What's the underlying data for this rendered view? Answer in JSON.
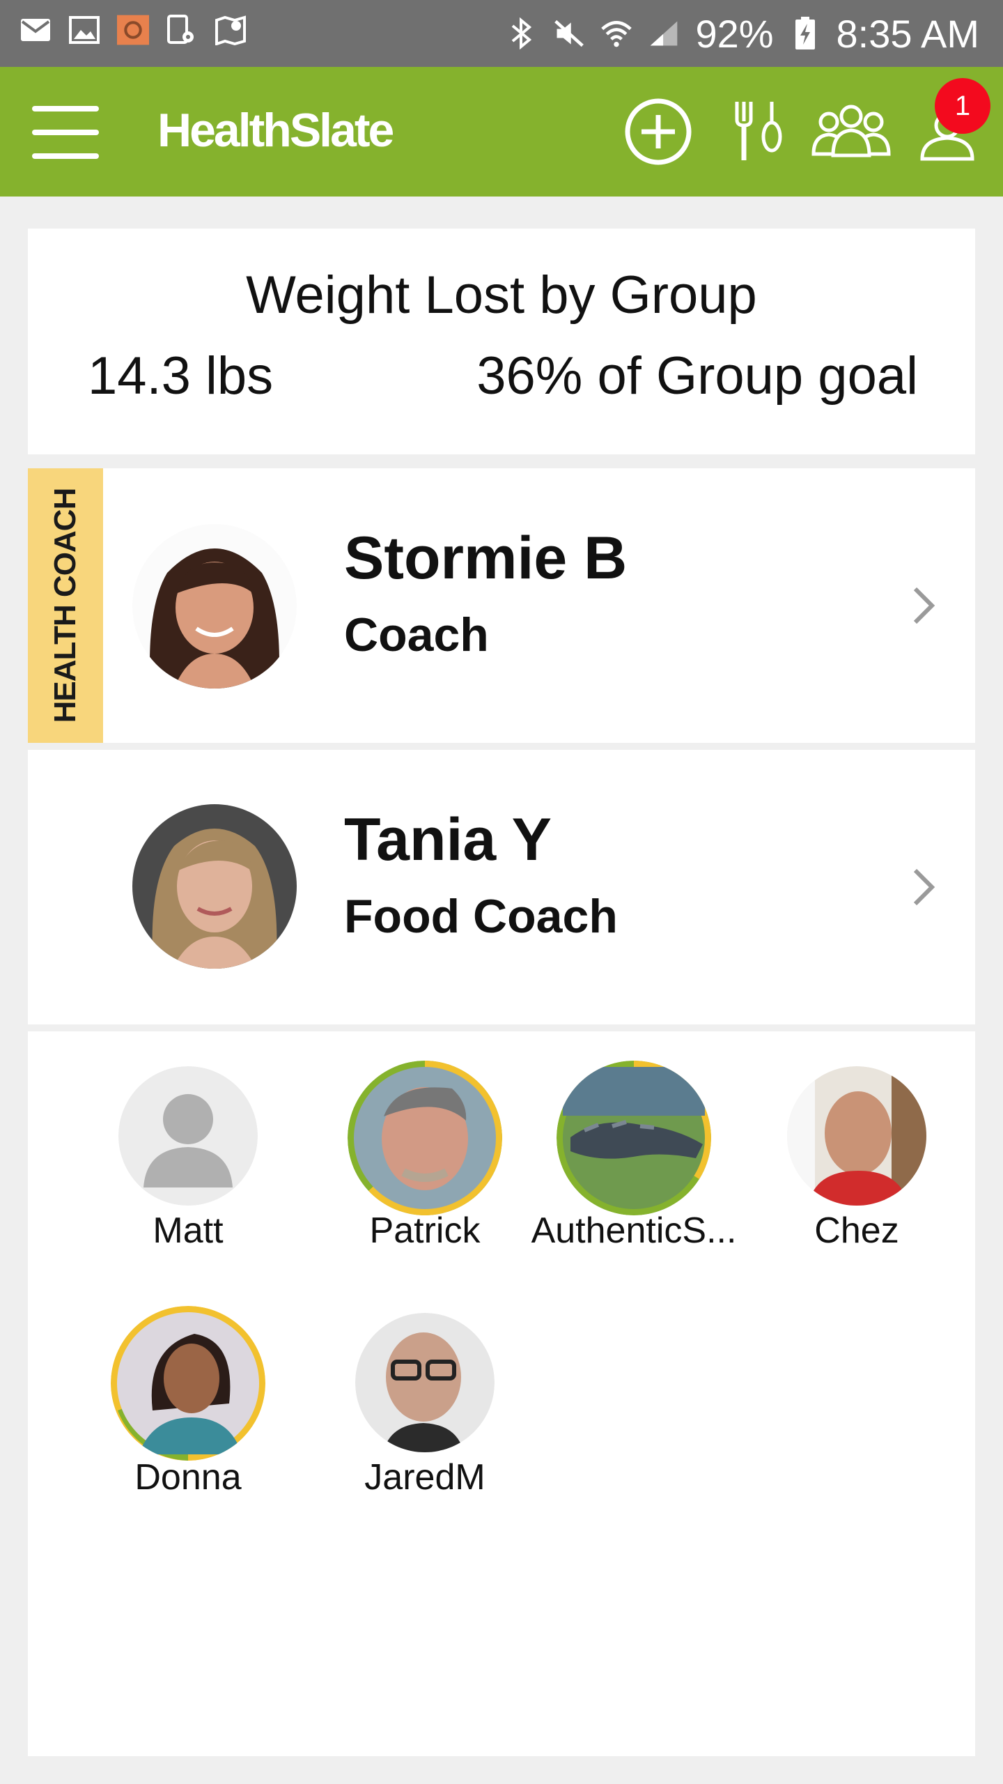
{
  "status_bar": {
    "battery": "92%",
    "time": "8:35 AM",
    "left_icons": [
      "mail-icon",
      "image-icon",
      "app-notification-icon",
      "device-settings-icon",
      "map-icon"
    ],
    "right_icons": [
      "bluetooth-icon",
      "mute-icon",
      "wifi-icon",
      "signal-icon",
      "battery-charging-icon"
    ]
  },
  "header": {
    "logo": "HealthSlate",
    "notification_count": "1",
    "bg_color": "#85b22d",
    "icons": [
      "menu-icon",
      "add-circle-icon",
      "fork-spoon-icon",
      "group-icon",
      "profile-icon"
    ]
  },
  "summary": {
    "title": "Weight Lost by Group",
    "lbs": "14.3 lbs",
    "goal": "36% of Group goal"
  },
  "coaches": [
    {
      "tag": "HEALTH COACH",
      "name": "Stormie B",
      "role": "Coach"
    },
    {
      "tag": "",
      "name": "Tania Y",
      "role": "Food Coach"
    }
  ],
  "members": [
    {
      "name": "Matt"
    },
    {
      "name": "Patrick"
    },
    {
      "name": "AuthenticS..."
    },
    {
      "name": "Chez"
    },
    {
      "name": "Donna"
    },
    {
      "name": "JaredM"
    }
  ]
}
